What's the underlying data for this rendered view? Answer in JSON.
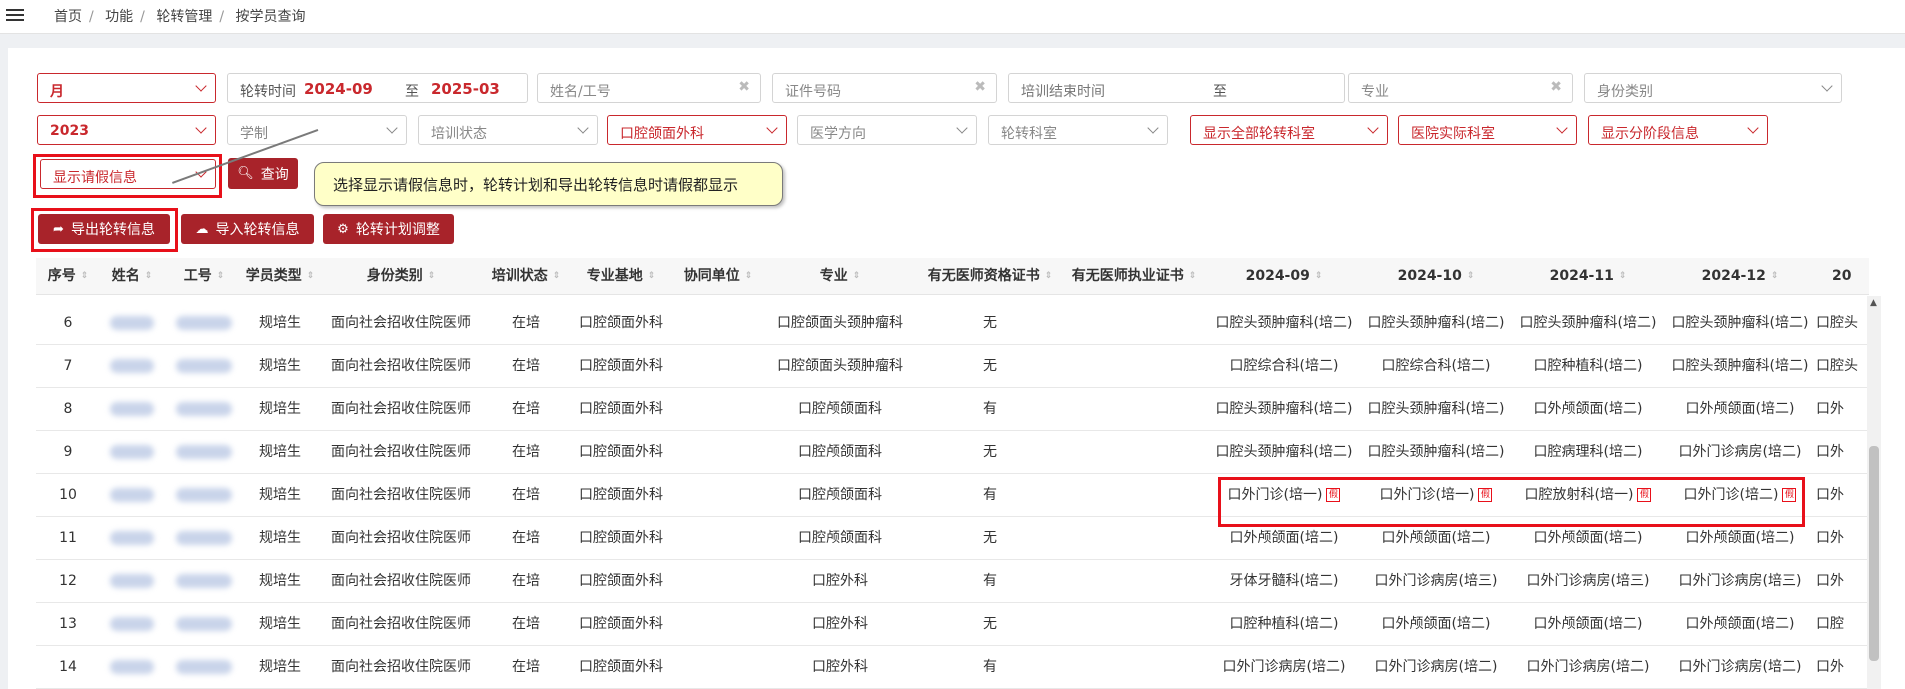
{
  "breadcrumb": [
    "首页",
    "功能",
    "轮转管理",
    "按学员查询"
  ],
  "filters": {
    "period": "月",
    "rotation_time_label": "轮转时间",
    "rotation_from": "2024-09",
    "rotation_to_sep": "至",
    "rotation_to": "2025-03",
    "name_placeholder": "姓名/工号",
    "cert_placeholder": "证件号码",
    "end_time_label": "培训结束时间",
    "end_time_sep": "至",
    "major_placeholder": "专业",
    "identity_placeholder": "身份类别",
    "year": "2023",
    "school_system": "学制",
    "training_status": "培训状态",
    "base": "口腔颌面外科",
    "direction": "医学方向",
    "dept": "轮转科室",
    "show_all_dept": "显示全部轮转科室",
    "hospital_dept": "医院实际科室",
    "show_stage": "显示分阶段信息",
    "show_leave": "显示请假信息"
  },
  "buttons": {
    "query": "查询",
    "export": "导出轮转信息",
    "import": "导入轮转信息",
    "adjust": "轮转计划调整"
  },
  "tooltip": "选择显示请假信息时，轮转计划和导出轮转信息时请假都显示",
  "table": {
    "headers": [
      "序号",
      "姓名",
      "工号",
      "学员类型",
      "身份类别",
      "培训状态",
      "专业基地",
      "协同单位",
      "专业",
      "有无医师资格证书",
      "有无医师执业证书",
      "2024-09",
      "2024-10",
      "2024-11",
      "2024-12",
      "20"
    ],
    "rows": [
      {
        "no": "6",
        "type": "规培生",
        "identity": "面向社会招收住院医师",
        "status": "在培",
        "base": "口腔颌面外科",
        "major": "口腔颌面头颈肿瘤科",
        "qual": "无",
        "m1": "口腔头颈肿瘤科(培二)",
        "m2": "口腔头颈肿瘤科(培二)",
        "m3": "口腔头颈肿瘤科(培二)",
        "m4": "口腔头颈肿瘤科(培二)",
        "m5": "口腔头"
      },
      {
        "no": "7",
        "type": "规培生",
        "identity": "面向社会招收住院医师",
        "status": "在培",
        "base": "口腔颌面外科",
        "major": "口腔颌面头颈肿瘤科",
        "qual": "无",
        "m1": "口腔综合科(培二)",
        "m2": "口腔综合科(培二)",
        "m3": "口腔种植科(培二)",
        "m4": "口腔头颈肿瘤科(培二)",
        "m5": "口腔头"
      },
      {
        "no": "8",
        "type": "规培生",
        "identity": "面向社会招收住院医师",
        "status": "在培",
        "base": "口腔颌面外科",
        "major": "口腔颅颌面科",
        "qual": "有",
        "m1": "口腔头颈肿瘤科(培二)",
        "m2": "口腔头颈肿瘤科(培二)",
        "m3": "口外颅颌面(培二)",
        "m4": "口外颅颌面(培二)",
        "m5": "口外"
      },
      {
        "no": "9",
        "type": "规培生",
        "identity": "面向社会招收住院医师",
        "status": "在培",
        "base": "口腔颌面外科",
        "major": "口腔颅颌面科",
        "qual": "无",
        "m1": "口腔头颈肿瘤科(培二)",
        "m2": "口腔头颈肿瘤科(培二)",
        "m3": "口腔病理科(培二)",
        "m4": "口外门诊病房(培二)",
        "m5": "口外"
      },
      {
        "no": "10",
        "type": "规培生",
        "identity": "面向社会招收住院医师",
        "status": "在培",
        "base": "口腔颌面外科",
        "major": "口腔颅颌面科",
        "qual": "有",
        "m1": "口外门诊(培一)",
        "m2": "口外门诊(培一)",
        "m3": "口腔放射科(培一)",
        "m4": "口外门诊(培二)",
        "m5": "口外"
      },
      {
        "no": "11",
        "type": "规培生",
        "identity": "面向社会招收住院医师",
        "status": "在培",
        "base": "口腔颌面外科",
        "major": "口腔颅颌面科",
        "qual": "无",
        "m1": "口外颅颌面(培二)",
        "m2": "口外颅颌面(培二)",
        "m3": "口外颅颌面(培二)",
        "m4": "口外颅颌面(培二)",
        "m5": "口外"
      },
      {
        "no": "12",
        "type": "规培生",
        "identity": "面向社会招收住院医师",
        "status": "在培",
        "base": "口腔颌面外科",
        "major": "口腔外科",
        "qual": "有",
        "m1": "牙体牙髓科(培二)",
        "m2": "口外门诊病房(培三)",
        "m3": "口外门诊病房(培三)",
        "m4": "口外门诊病房(培三)",
        "m5": "口外"
      },
      {
        "no": "13",
        "type": "规培生",
        "identity": "面向社会招收住院医师",
        "status": "在培",
        "base": "口腔颌面外科",
        "major": "口腔外科",
        "qual": "无",
        "m1": "口腔种植科(培二)",
        "m2": "口外颅颌面(培二)",
        "m3": "口外颅颌面(培二)",
        "m4": "口外颅颌面(培二)",
        "m5": "口腔"
      },
      {
        "no": "14",
        "type": "规培生",
        "identity": "面向社会招收住院医师",
        "status": "在培",
        "base": "口腔颌面外科",
        "major": "口腔外科",
        "qual": "有",
        "m1": "口外门诊病房(培二)",
        "m2": "口外门诊病房(培二)",
        "m3": "口外门诊病房(培二)",
        "m4": "口外门诊病房(培二)",
        "m5": "口外"
      }
    ],
    "leave_mark": "假"
  }
}
